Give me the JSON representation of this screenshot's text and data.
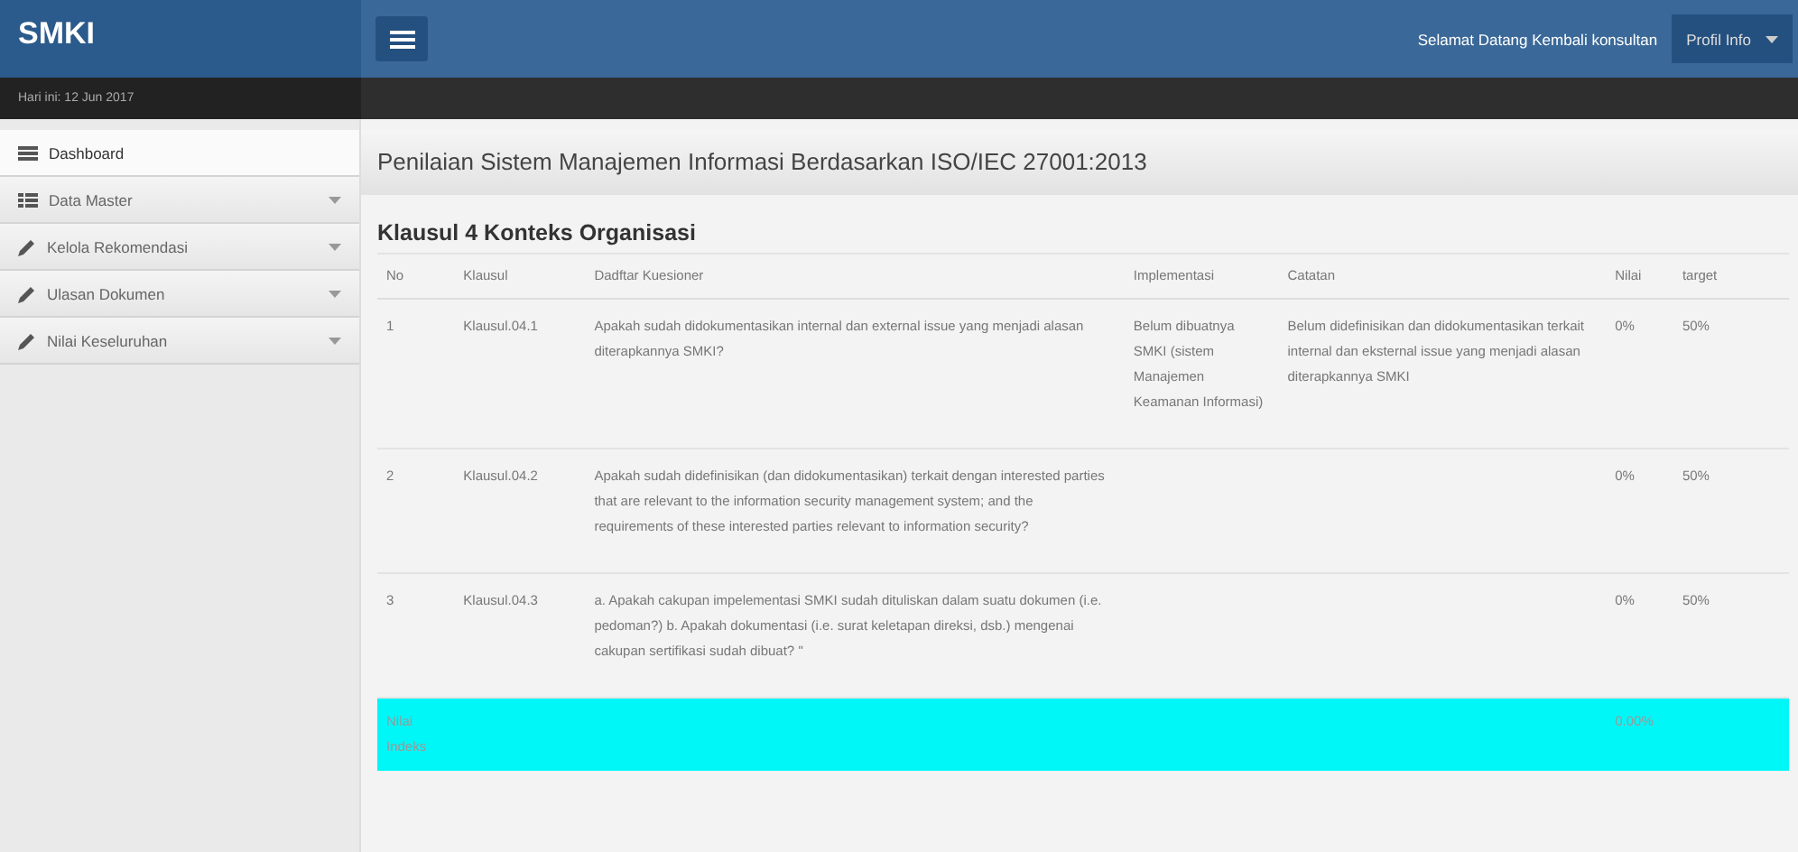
{
  "brand": "SMKI",
  "date": "Hari ini: 12 Jun 2017",
  "welcome": "Selamat Datang Kembali konsultan",
  "profile_menu": "Profil Info",
  "sidebar": {
    "items": [
      {
        "label": "Dashboard",
        "selected": true,
        "expandable": false
      },
      {
        "label": "Data Master",
        "selected": false,
        "expandable": true
      },
      {
        "label": "Kelola Rekomendasi",
        "selected": false,
        "expandable": true
      },
      {
        "label": "Ulasan Dokumen",
        "selected": false,
        "expandable": true
      },
      {
        "label": "Nilai Keseluruhan",
        "selected": false,
        "expandable": true
      }
    ]
  },
  "page_title": "Penilaian Sistem Manajemen Informasi Berdasarkan ISO/IEC 27001:2013",
  "section_title": "Klausul 4 Konteks Organisasi",
  "table": {
    "columns": [
      "No",
      "Klausul",
      "Dadftar Kuesioner",
      "Implementasi",
      "Catatan",
      "Nilai",
      "target"
    ],
    "rows": [
      [
        "1",
        "Klausul.04.1",
        "Apakah sudah didokumentasikan internal dan external issue yang menjadi alasan diterapkannya SMKI?",
        "Belum dibuatnya SMKI (sistem Manajemen Keamanan Informasi)",
        "Belum didefinisikan dan didokumentasikan terkait internal dan eksternal issue yang menjadi alasan diterapkannya SMKI",
        "0%",
        "50%"
      ],
      [
        "2",
        "Klausul.04.2",
        "Apakah sudah didefinisikan (dan didokumentasikan) terkait dengan interested parties that are relevant to the information security management system; and the requirements of these interested parties relevant to information security?",
        "",
        "",
        "0%",
        "50%"
      ],
      [
        "3",
        "Klausul.04.3",
        "a. Apakah cakupan impelementasi SMKI sudah dituliskan dalam suatu dokumen (i.e. pedoman?) b. Apakah dokumentasi (i.e. surat keletapan direksi, dsb.) mengenai cakupan sertifikasi sudah dibuat? \"",
        "",
        "",
        "0%",
        "50%"
      ]
    ],
    "summary": {
      "label": "Nilai Indeks",
      "value": "0.00%"
    }
  }
}
